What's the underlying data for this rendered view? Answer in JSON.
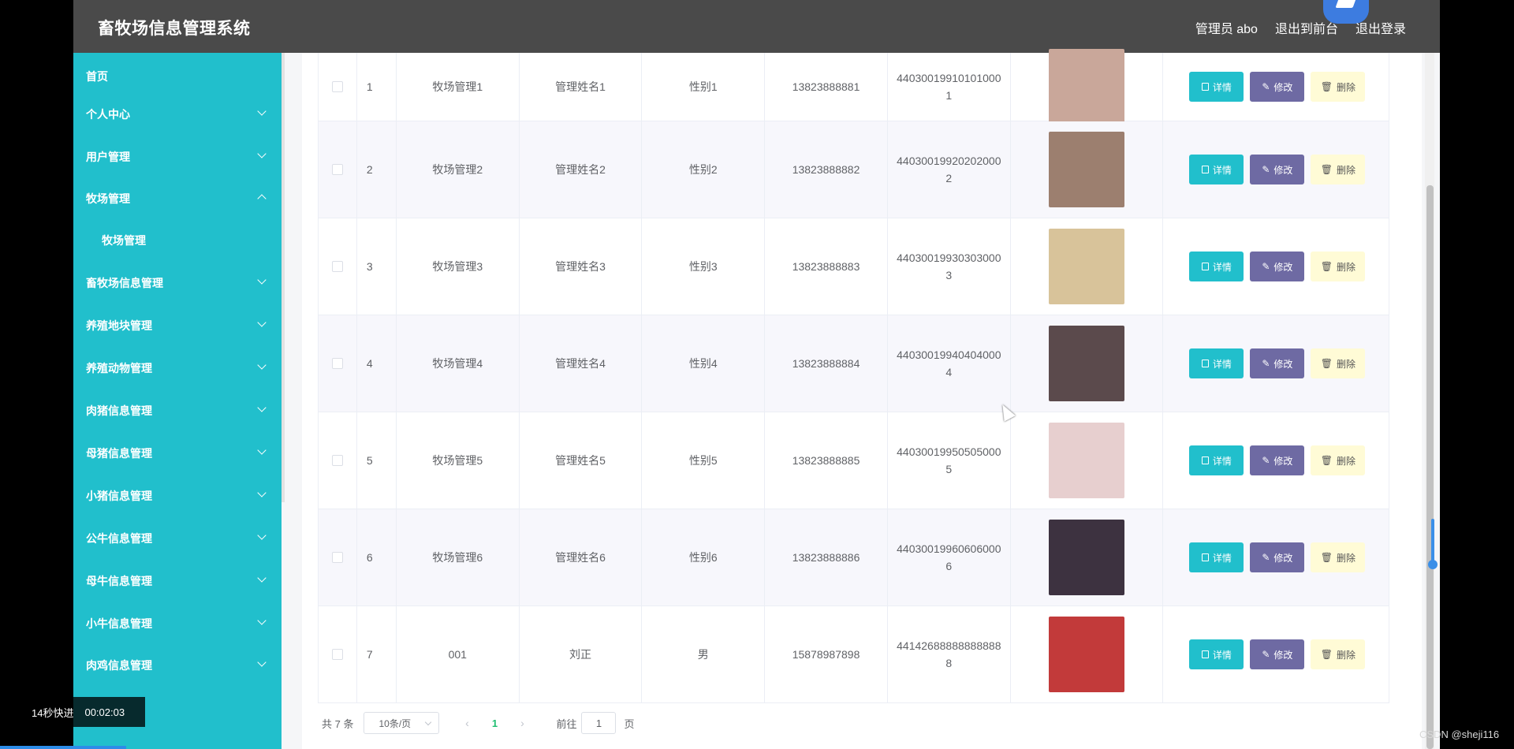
{
  "header": {
    "title": "畜牧场信息管理系统",
    "user_label": "管理员 abo",
    "front_link": "退出到前台",
    "logout_link": "退出登录"
  },
  "sidebar": {
    "items": [
      {
        "label": "首页"
      },
      {
        "label": "个人中心"
      },
      {
        "label": "用户管理"
      },
      {
        "label": "牧场管理",
        "expanded": true
      },
      {
        "label": "牧场管理",
        "sub": true
      },
      {
        "label": "畜牧场信息管理"
      },
      {
        "label": "养殖地块管理"
      },
      {
        "label": "养殖动物管理"
      },
      {
        "label": "肉猪信息管理"
      },
      {
        "label": "母猪信息管理"
      },
      {
        "label": "小猪信息管理"
      },
      {
        "label": "公牛信息管理"
      },
      {
        "label": "母牛信息管理"
      },
      {
        "label": "小牛信息管理"
      },
      {
        "label": "肉鸡信息管理"
      }
    ],
    "accent_color": "#21bfcc"
  },
  "table": {
    "rows": [
      {
        "idx": "1",
        "name": "牧场管理1",
        "manager": "管理姓名1",
        "sex": "性别1",
        "phone": "13823888881",
        "id_no": "440300199101010001",
        "photo_color": "#c9a79a"
      },
      {
        "idx": "2",
        "name": "牧场管理2",
        "manager": "管理姓名2",
        "sex": "性别2",
        "phone": "13823888882",
        "id_no": "440300199202020002",
        "photo_color": "#9c7f6f"
      },
      {
        "idx": "3",
        "name": "牧场管理3",
        "manager": "管理姓名3",
        "sex": "性别3",
        "phone": "13823888883",
        "id_no": "440300199303030003",
        "photo_color": "#d8c39a"
      },
      {
        "idx": "4",
        "name": "牧场管理4",
        "manager": "管理姓名4",
        "sex": "性别4",
        "phone": "13823888884",
        "id_no": "440300199404040004",
        "photo_color": "#5b4a4c"
      },
      {
        "idx": "5",
        "name": "牧场管理5",
        "manager": "管理姓名5",
        "sex": "性别5",
        "phone": "13823888885",
        "id_no": "440300199505050005",
        "photo_color": "#e7cfcf"
      },
      {
        "idx": "6",
        "name": "牧场管理6",
        "manager": "管理姓名6",
        "sex": "性别6",
        "phone": "13823888886",
        "id_no": "440300199606060006",
        "photo_color": "#3d3240"
      },
      {
        "idx": "7",
        "name": "001",
        "manager": "刘正",
        "sex": "男",
        "phone": "15878987898",
        "id_no": "441426888888888888",
        "photo_color": "#c23a3a"
      }
    ],
    "actions": {
      "detail": "详情",
      "edit": "修改",
      "delete": "删除"
    }
  },
  "pagination": {
    "total": "共 7 条",
    "page_size": "10条/页",
    "current_page": "1",
    "goto_label": "前往",
    "goto_value": "1",
    "page_unit": "页"
  },
  "overlay": {
    "speed": "14秒快进",
    "timestamp": "00:02:03",
    "watermark": "CSDN @sheji116"
  }
}
